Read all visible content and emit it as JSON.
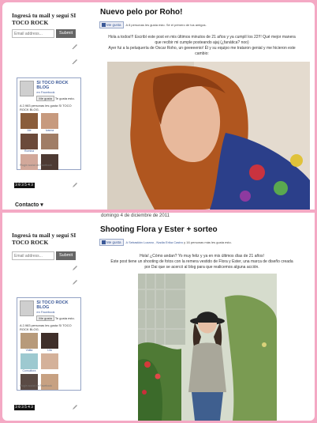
{
  "sidebar": {
    "subscribe_title": "Ingresá tu mail y seguí SI TOCO ROCK",
    "email_placeholder": "Email address...",
    "submit_label": "Submit",
    "fb_page_name": "SI TOCO ROCK BLOG",
    "fb_on_facebook": "en Facebook",
    "fb_like_label": "Me gusta",
    "fb_te_gusta": "Te gusta esto.",
    "fb_plugin": "Plugin social de Facebook",
    "counter": "303543",
    "contacto": "Contacto ▾"
  },
  "panel1": {
    "fb_count_text": "A 2,983 personas les gusta SI TOCO ROCK BLOG.",
    "faces": [
      "Ale",
      "Ivanna",
      "Romina"
    ],
    "post_title": "Nuevo pelo por Roho!",
    "like_label": "Me gusta",
    "like_text": "A 8 personas les gusta esto. Sé el primero de tus amigos.",
    "body_lines": [
      "Hola a todos!!! Escribí este post en mis últimos minutos de 21 años y ya cumplí los 22!!! Qué mejor manera",
      "que recibir mi cumple posteando ajaj (¿fanática? noo)",
      "Ayer fui a la peluquería de Oscar Roho, un geeeeenio! Él y su equipo me trataron genial y me hicieron este",
      "cambio:"
    ]
  },
  "panel2": {
    "date_header": "domingo 4 de diciembre de 2011",
    "fb_count_text": "A 2,983 personas les gusta SI TOCO ROCK BLOG.",
    "faces": [
      "Vidita",
      "Lila",
      "Consultora"
    ],
    "post_title": "Shooting Flora y Ester + sorteo",
    "like_label": "Me gusta",
    "like_names": "A Sebastián Lozano , Nadia Erika Castro",
    "like_rest": " y 16 personas más les gusta esto.",
    "body_lines": [
      "Hola! ¿Cómo andan? Yo muy feliz y ya en mis últimos días de 21 años!",
      "Este post tiene un shooting de fotos con la remera vestido de Flora y Ester, una marca de diseño creada",
      "por Dai que se acercó al blog para que realicemos alguna acción."
    ]
  },
  "colors": {
    "frame": "#f4a9c4",
    "facebook_blue": "#3b5998"
  }
}
